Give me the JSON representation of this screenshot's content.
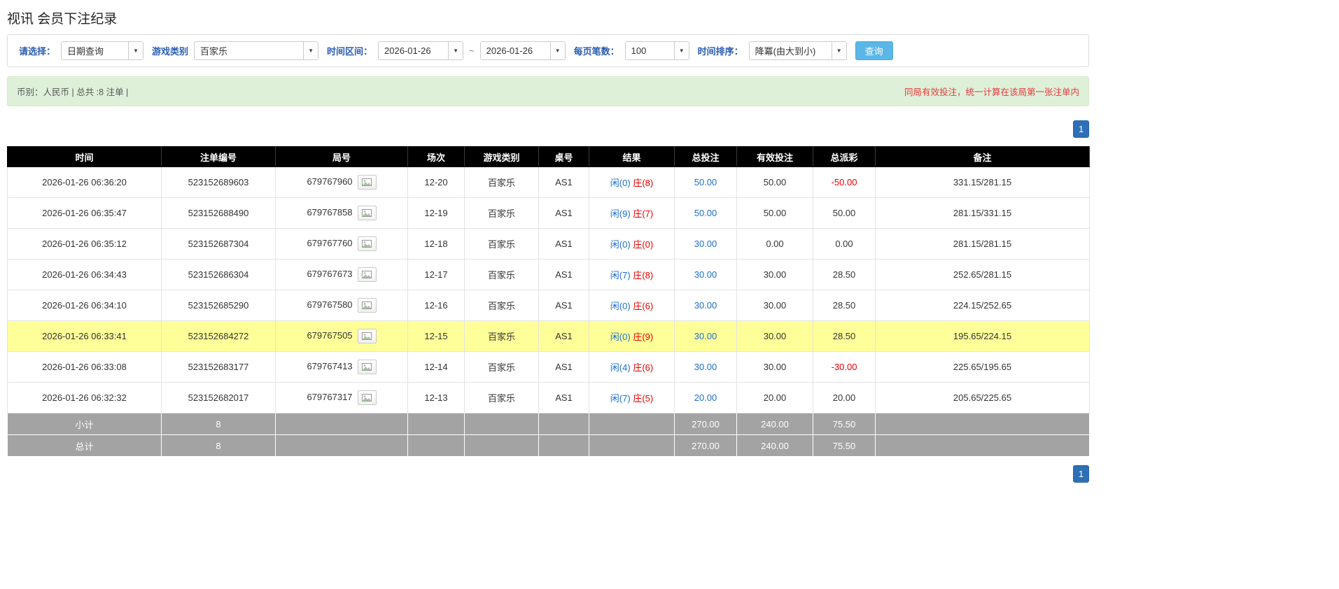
{
  "page": {
    "title": "视讯 会员下注纪录"
  },
  "filters": {
    "select_label": "请选择：",
    "select_value": "日期查询",
    "game_type_label": "游戏类别",
    "game_type_value": "百家乐",
    "date_range_label": "时间区间：",
    "date_from": "2026-01-26",
    "tilde": "~",
    "date_to": "2026-01-26",
    "page_size_label": "每页笔数：",
    "page_size_value": "100",
    "sort_label": "时间排序：",
    "sort_value": "降冪(由大到小)",
    "search_button": "查询",
    "dropdown_arrow": "▼"
  },
  "summary_bar": {
    "left": "币别：人民币 | 总共 :8 注单 |",
    "right": "同局有效投注，统一计算在该局第一张注单内"
  },
  "pagination": {
    "page": "1"
  },
  "table": {
    "headers": [
      "时间",
      "注单编号",
      "局号",
      "场次",
      "游戏类别",
      "桌号",
      "结果",
      "总投注",
      "有效投注",
      "总派彩",
      "备注"
    ],
    "rows": [
      {
        "time": "2026-01-26 06:36:20",
        "bet_id": "523152689603",
        "round_id": "679767960",
        "session": "12-20",
        "game": "百家乐",
        "table_no": "AS1",
        "player": "闲(0)",
        "banker": "庄(8)",
        "total_bet": "50.00",
        "valid_bet": "50.00",
        "payout": "-50.00",
        "note": "331.15/281.15",
        "highlight": false
      },
      {
        "time": "2026-01-26 06:35:47",
        "bet_id": "523152688490",
        "round_id": "679767858",
        "session": "12-19",
        "game": "百家乐",
        "table_no": "AS1",
        "player": "闲(9)",
        "banker": "庄(7)",
        "total_bet": "50.00",
        "valid_bet": "50.00",
        "payout": "50.00",
        "note": "281.15/331.15",
        "highlight": false
      },
      {
        "time": "2026-01-26 06:35:12",
        "bet_id": "523152687304",
        "round_id": "679767760",
        "session": "12-18",
        "game": "百家乐",
        "table_no": "AS1",
        "player": "闲(0)",
        "banker": "庄(0)",
        "total_bet": "30.00",
        "valid_bet": "0.00",
        "payout": "0.00",
        "note": "281.15/281.15",
        "highlight": false
      },
      {
        "time": "2026-01-26 06:34:43",
        "bet_id": "523152686304",
        "round_id": "679767673",
        "session": "12-17",
        "game": "百家乐",
        "table_no": "AS1",
        "player": "闲(7)",
        "banker": "庄(8)",
        "total_bet": "30.00",
        "valid_bet": "30.00",
        "payout": "28.50",
        "note": "252.65/281.15",
        "highlight": false
      },
      {
        "time": "2026-01-26 06:34:10",
        "bet_id": "523152685290",
        "round_id": "679767580",
        "session": "12-16",
        "game": "百家乐",
        "table_no": "AS1",
        "player": "闲(0)",
        "banker": "庄(6)",
        "total_bet": "30.00",
        "valid_bet": "30.00",
        "payout": "28.50",
        "note": "224.15/252.65",
        "highlight": false
      },
      {
        "time": "2026-01-26 06:33:41",
        "bet_id": "523152684272",
        "round_id": "679767505",
        "session": "12-15",
        "game": "百家乐",
        "table_no": "AS1",
        "player": "闲(0)",
        "banker": "庄(9)",
        "total_bet": "30.00",
        "valid_bet": "30.00",
        "payout": "28.50",
        "note": "195.65/224.15",
        "highlight": true
      },
      {
        "time": "2026-01-26 06:33:08",
        "bet_id": "523152683177",
        "round_id": "679767413",
        "session": "12-14",
        "game": "百家乐",
        "table_no": "AS1",
        "player": "闲(4)",
        "banker": "庄(6)",
        "total_bet": "30.00",
        "valid_bet": "30.00",
        "payout": "-30.00",
        "note": "225.65/195.65",
        "highlight": false
      },
      {
        "time": "2026-01-26 06:32:32",
        "bet_id": "523152682017",
        "round_id": "679767317",
        "session": "12-13",
        "game": "百家乐",
        "table_no": "AS1",
        "player": "闲(7)",
        "banker": "庄(5)",
        "total_bet": "20.00",
        "valid_bet": "20.00",
        "payout": "20.00",
        "note": "205.65/225.65",
        "highlight": false
      }
    ],
    "subtotal": {
      "label": "小计",
      "count": "8",
      "total_bet": "270.00",
      "valid_bet": "240.00",
      "payout": "75.50"
    },
    "total": {
      "label": "总计",
      "count": "8",
      "total_bet": "270.00",
      "valid_bet": "240.00",
      "payout": "75.50"
    }
  }
}
